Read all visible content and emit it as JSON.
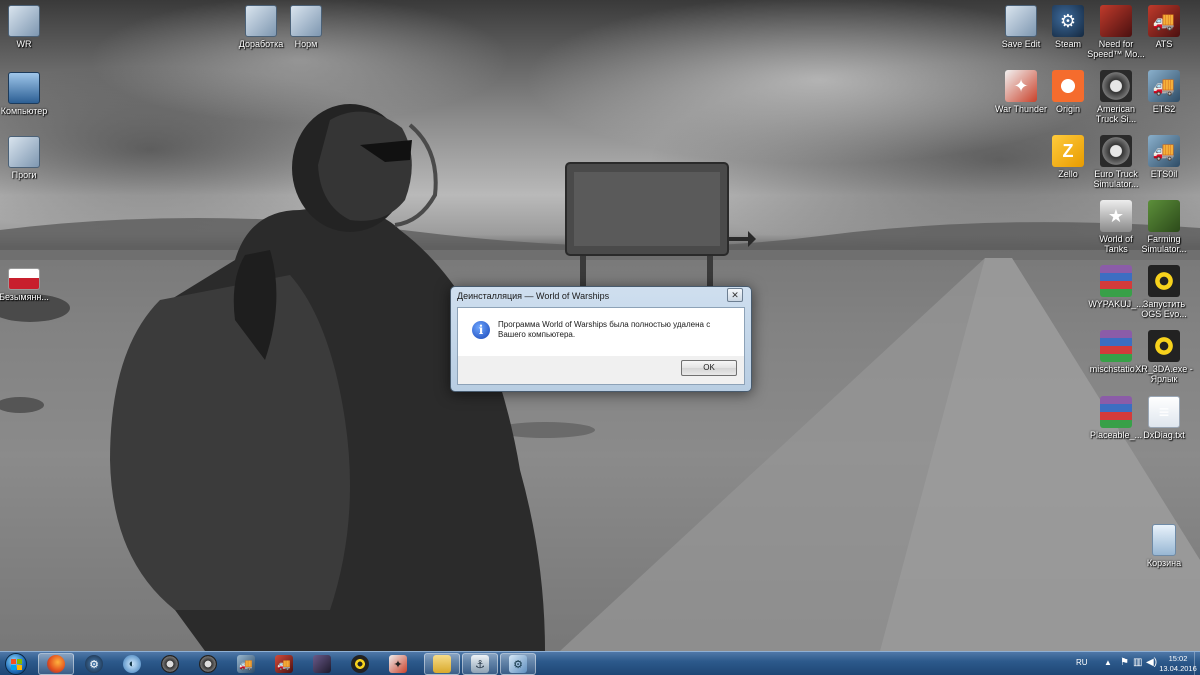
{
  "desktop": {
    "icons_left": [
      {
        "label": "WR",
        "icon": "folder-icon"
      },
      {
        "label": "Компьютер",
        "icon": "computer-icon"
      },
      {
        "label": "Проги",
        "icon": "folder-icon"
      },
      {
        "label": "Безымянн...",
        "icon": "image-file-icon"
      }
    ],
    "icons_top": [
      {
        "label": "Доработка",
        "icon": "folder-icon"
      },
      {
        "label": "Норм",
        "icon": "folder-icon"
      }
    ],
    "icons_right": [
      {
        "label": "Save Edit",
        "icon": "folder-icon"
      },
      {
        "label": "Steam",
        "icon": "steam-icon"
      },
      {
        "label": "Need for\nSpeed™ Mo...",
        "icon": "nfs-icon"
      },
      {
        "label": "ATS",
        "icon": "truck-icon"
      },
      {
        "label": "War Thunder",
        "icon": "war-thunder-icon"
      },
      {
        "label": "Origin",
        "icon": "origin-icon"
      },
      {
        "label": "American\nTruck Si...",
        "icon": "gear-icon"
      },
      {
        "label": "ETS2",
        "icon": "truck-icon"
      },
      {
        "label": "Zello",
        "icon": "zello-icon"
      },
      {
        "label": "Euro Truck\nSimulator...",
        "icon": "gear-icon"
      },
      {
        "label": "ETS0il",
        "icon": "truck-icon"
      },
      {
        "label": "World of\nTanks",
        "icon": "world-of-tanks-icon"
      },
      {
        "label": "Farming\nSimulator...",
        "icon": "farming-simulator-icon"
      },
      {
        "label": "WYPAKUJ_...",
        "icon": "winrar-icon"
      },
      {
        "label": "Запустить\nOGS Evo...",
        "icon": "radiation-icon"
      },
      {
        "label": "mischstatio...",
        "icon": "winrar-icon"
      },
      {
        "label": "XR_3DA.exe -\nЯрлык",
        "icon": "radiation-icon"
      },
      {
        "label": "Placeable_...",
        "icon": "winrar-icon"
      },
      {
        "label": "DxDiag.txt",
        "icon": "text-file-icon"
      },
      {
        "label": "Корзина",
        "icon": "recycle-bin-icon"
      }
    ]
  },
  "dialog": {
    "title": "Деинсталляция — World of Warships",
    "close_glyph": "✕",
    "message": "Программа World of Warships была полностью удалена с Вашего компьютера.",
    "ok_label": "OK",
    "icon": "info-icon"
  },
  "taskbar": {
    "start": "start-orb",
    "items": [
      {
        "name": "firefox",
        "icon": "firefox-icon",
        "active": true
      },
      {
        "name": "steam",
        "icon": "steam-icon",
        "active": false
      },
      {
        "name": "app",
        "icon": "globe-icon",
        "active": false
      },
      {
        "name": "ats",
        "icon": "gear-icon",
        "active": false
      },
      {
        "name": "ets2",
        "icon": "gear-icon",
        "active": false
      },
      {
        "name": "truck1",
        "icon": "truck-icon",
        "active": false
      },
      {
        "name": "truck2",
        "icon": "truck-icon",
        "active": false
      },
      {
        "name": "game",
        "icon": "game-icon",
        "active": false
      },
      {
        "name": "stalker",
        "icon": "radiation-icon",
        "active": false
      },
      {
        "name": "war-thunder",
        "icon": "war-thunder-icon",
        "active": false
      },
      {
        "name": "explorer",
        "icon": "folder-icon",
        "active": true
      },
      {
        "name": "wows",
        "icon": "world-of-warships-icon",
        "active": true
      },
      {
        "name": "installer",
        "icon": "installer-icon",
        "active": true
      }
    ],
    "tray": {
      "language": "RU",
      "time": "15:02",
      "date": "13.04.2016"
    }
  },
  "colors": {
    "taskbar": "#2d5a8c",
    "dialog_frame": "#b8cde2",
    "info_blue": "#1745b6"
  }
}
